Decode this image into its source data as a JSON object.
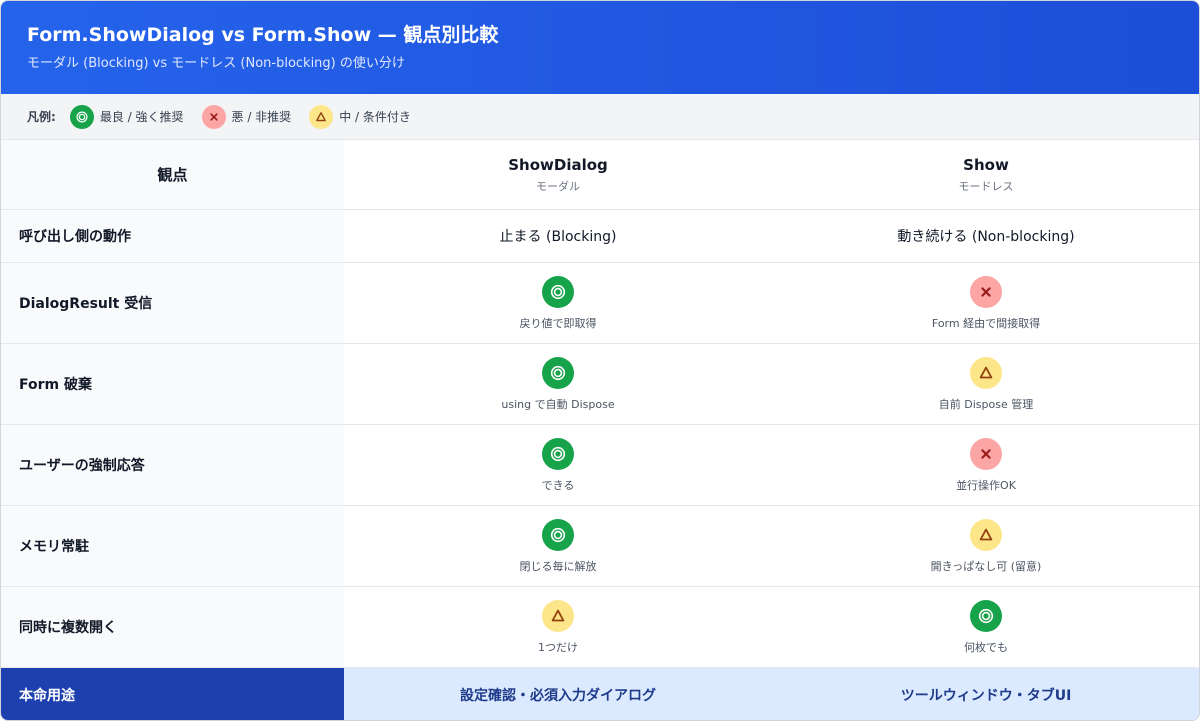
{
  "header": {
    "title": "Form.ShowDialog vs Form.Show — 観点別比較",
    "subtitle": "モーダル (Blocking) vs モードレス (Non-blocking) の使い分け"
  },
  "legend": {
    "title": "凡例:",
    "items": [
      {
        "rating": "good",
        "icon": "double-circle-icon",
        "label": "最良 / 強く推奨"
      },
      {
        "rating": "bad",
        "icon": "cross-icon",
        "label": "悪 / 非推奨"
      },
      {
        "rating": "mid",
        "icon": "triangle-icon",
        "label": "中 / 条件付き"
      }
    ]
  },
  "columns": {
    "aspect": "観点",
    "showdialog": {
      "title": "ShowDialog",
      "subtitle": "モーダル"
    },
    "show": {
      "title": "Show",
      "subtitle": "モードレス"
    }
  },
  "rows": [
    {
      "aspect": "呼び出し側の動作",
      "showdialog": {
        "text": "止まる (Blocking)"
      },
      "show": {
        "text": "動き続ける (Non-blocking)"
      }
    },
    {
      "aspect": "DialogResult 受信",
      "showdialog": {
        "rating": "good",
        "note": "戻り値で即取得"
      },
      "show": {
        "rating": "bad",
        "note": "Form 経由で間接取得"
      }
    },
    {
      "aspect": "Form 破棄",
      "showdialog": {
        "rating": "good",
        "note": "using で自動 Dispose"
      },
      "show": {
        "rating": "mid",
        "note": "自前 Dispose 管理"
      }
    },
    {
      "aspect": "ユーザーの強制応答",
      "showdialog": {
        "rating": "good",
        "note": "できる"
      },
      "show": {
        "rating": "bad",
        "note": "並行操作OK"
      }
    },
    {
      "aspect": "メモリ常駐",
      "showdialog": {
        "rating": "good",
        "note": "閉じる毎に解放"
      },
      "show": {
        "rating": "mid",
        "note": "開きっぱなし可 (留意)"
      }
    },
    {
      "aspect": "同時に複数開く",
      "showdialog": {
        "rating": "mid",
        "note": "1つだけ"
      },
      "show": {
        "rating": "good",
        "note": "何枚でも"
      }
    }
  ],
  "footer": {
    "aspect": "本命用途",
    "showdialog": "設定確認・必須入力ダイアログ",
    "show": "ツールウィンドウ・タブUI"
  },
  "colors": {
    "header_start": "#2563eb",
    "header_end": "#1d4ed8",
    "good": "#16a34a",
    "bad": "#fca5a5",
    "mid": "#fde68a",
    "footer_label_bg": "#1e40af",
    "footer_value_bg": "#dbeafe"
  }
}
